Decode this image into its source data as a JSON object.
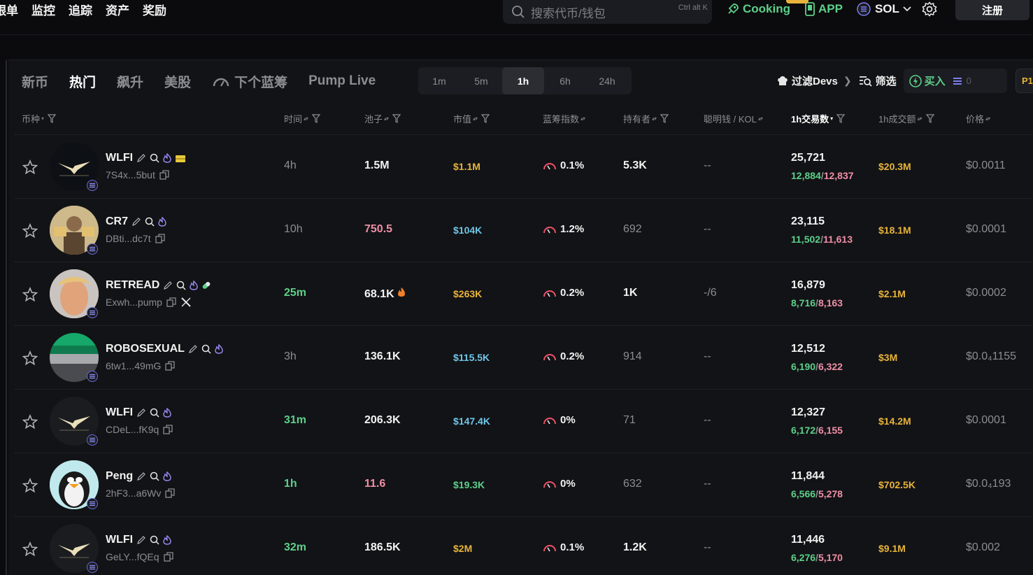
{
  "topnav": [
    "跟单",
    "监控",
    "追踪",
    "资产",
    "奖励"
  ],
  "search": {
    "placeholder": "搜索代币/钱包",
    "shortcut": "Ctrl alt K"
  },
  "cooking_label": "Cooking",
  "app_label": "APP",
  "chain_label": "SOL",
  "register_label": "注册",
  "tabs": [
    {
      "label": "新币",
      "active": false
    },
    {
      "label": "热门",
      "active": true
    },
    {
      "label": "飙升",
      "active": false
    },
    {
      "label": "美股",
      "active": false
    },
    {
      "label": "下个蓝筹",
      "active": false
    },
    {
      "label": "Pump Live",
      "active": false
    }
  ],
  "time_segments": [
    {
      "label": "1m",
      "active": false
    },
    {
      "label": "5m",
      "active": false
    },
    {
      "label": "1h",
      "active": true
    },
    {
      "label": "6h",
      "active": false
    },
    {
      "label": "24h",
      "active": false
    }
  ],
  "filters": {
    "filter_devs": "过滤Devs",
    "screen": "筛选",
    "buy": "买入",
    "buy_amount": "0",
    "preset": "P1"
  },
  "columns": {
    "coin": "币种",
    "time": "时间",
    "pool": "池子",
    "mcap": "市值",
    "bluechip": "蓝筹指数",
    "holders": "持有者",
    "smart": "聪明钱 / KOL",
    "tx": "1h交易数",
    "vol": "1h成交额",
    "price": "价格"
  },
  "colors": {
    "green": "#5cd08a",
    "pink": "#f08fa6",
    "gold": "#e8b33a",
    "blue": "#6fc7e8",
    "muted": "#8b8d93",
    "panel": "#121316"
  },
  "rows": [
    {
      "symbol": "WLFI",
      "address": "7S4x...5but",
      "time": "4h",
      "pool": "1.5M",
      "mcap": "$1.1M",
      "bluechip": "0.1%",
      "holders": "5.3K",
      "smart": "--",
      "tx": "25,721",
      "tx_buy": "12,884",
      "tx_sell": "12,837",
      "vol": "$20.3M",
      "price": "$0.0011"
    },
    {
      "symbol": "CR7",
      "address": "DBti...dc7t",
      "time": "10h",
      "pool": "750.5",
      "mcap": "$104K",
      "bluechip": "1.2%",
      "holders": "692",
      "smart": "--",
      "tx": "23,115",
      "tx_buy": "11,502",
      "tx_sell": "11,613",
      "vol": "$18.1M",
      "price": "$0.0001"
    },
    {
      "symbol": "RETREAD",
      "address": "Exwh...pump",
      "time": "25m",
      "pool": "68.1K",
      "mcap": "$263K",
      "bluechip": "0.2%",
      "holders": "1K",
      "smart": "-/6",
      "tx": "16,879",
      "tx_buy": "8,716",
      "tx_sell": "8,163",
      "vol": "$2.1M",
      "price": "$0.0002"
    },
    {
      "symbol": "ROBOSEXUAL",
      "address": "6tw1...49mG",
      "time": "3h",
      "pool": "136.1K",
      "mcap": "$115.5K",
      "bluechip": "0.2%",
      "holders": "914",
      "smart": "--",
      "tx": "12,512",
      "tx_buy": "6,190",
      "tx_sell": "6,322",
      "vol": "$3M",
      "price": "$0.0₄1155"
    },
    {
      "symbol": "WLFI",
      "address": "CDeL...fK9q",
      "time": "31m",
      "pool": "206.3K",
      "mcap": "$147.4K",
      "bluechip": "0%",
      "holders": "71",
      "smart": "--",
      "tx": "12,327",
      "tx_buy": "6,172",
      "tx_sell": "6,155",
      "vol": "$14.2M",
      "price": "$0.0001"
    },
    {
      "symbol": "Peng",
      "address": "2hF3...a6Wv",
      "time": "1h",
      "pool": "11.6",
      "mcap": "$19.3K",
      "bluechip": "0%",
      "holders": "632",
      "smart": "--",
      "tx": "11,844",
      "tx_buy": "6,566",
      "tx_sell": "5,278",
      "vol": "$702.5K",
      "price": "$0.0₄193"
    },
    {
      "symbol": "WLFI",
      "address": "GeLY...fQEq",
      "time": "32m",
      "pool": "186.5K",
      "mcap": "$2M",
      "bluechip": "0.1%",
      "holders": "1.2K",
      "smart": "--",
      "tx": "11,446",
      "tx_buy": "6,276",
      "tx_sell": "5,170",
      "vol": "$9.1M",
      "price": "$0.002"
    }
  ]
}
